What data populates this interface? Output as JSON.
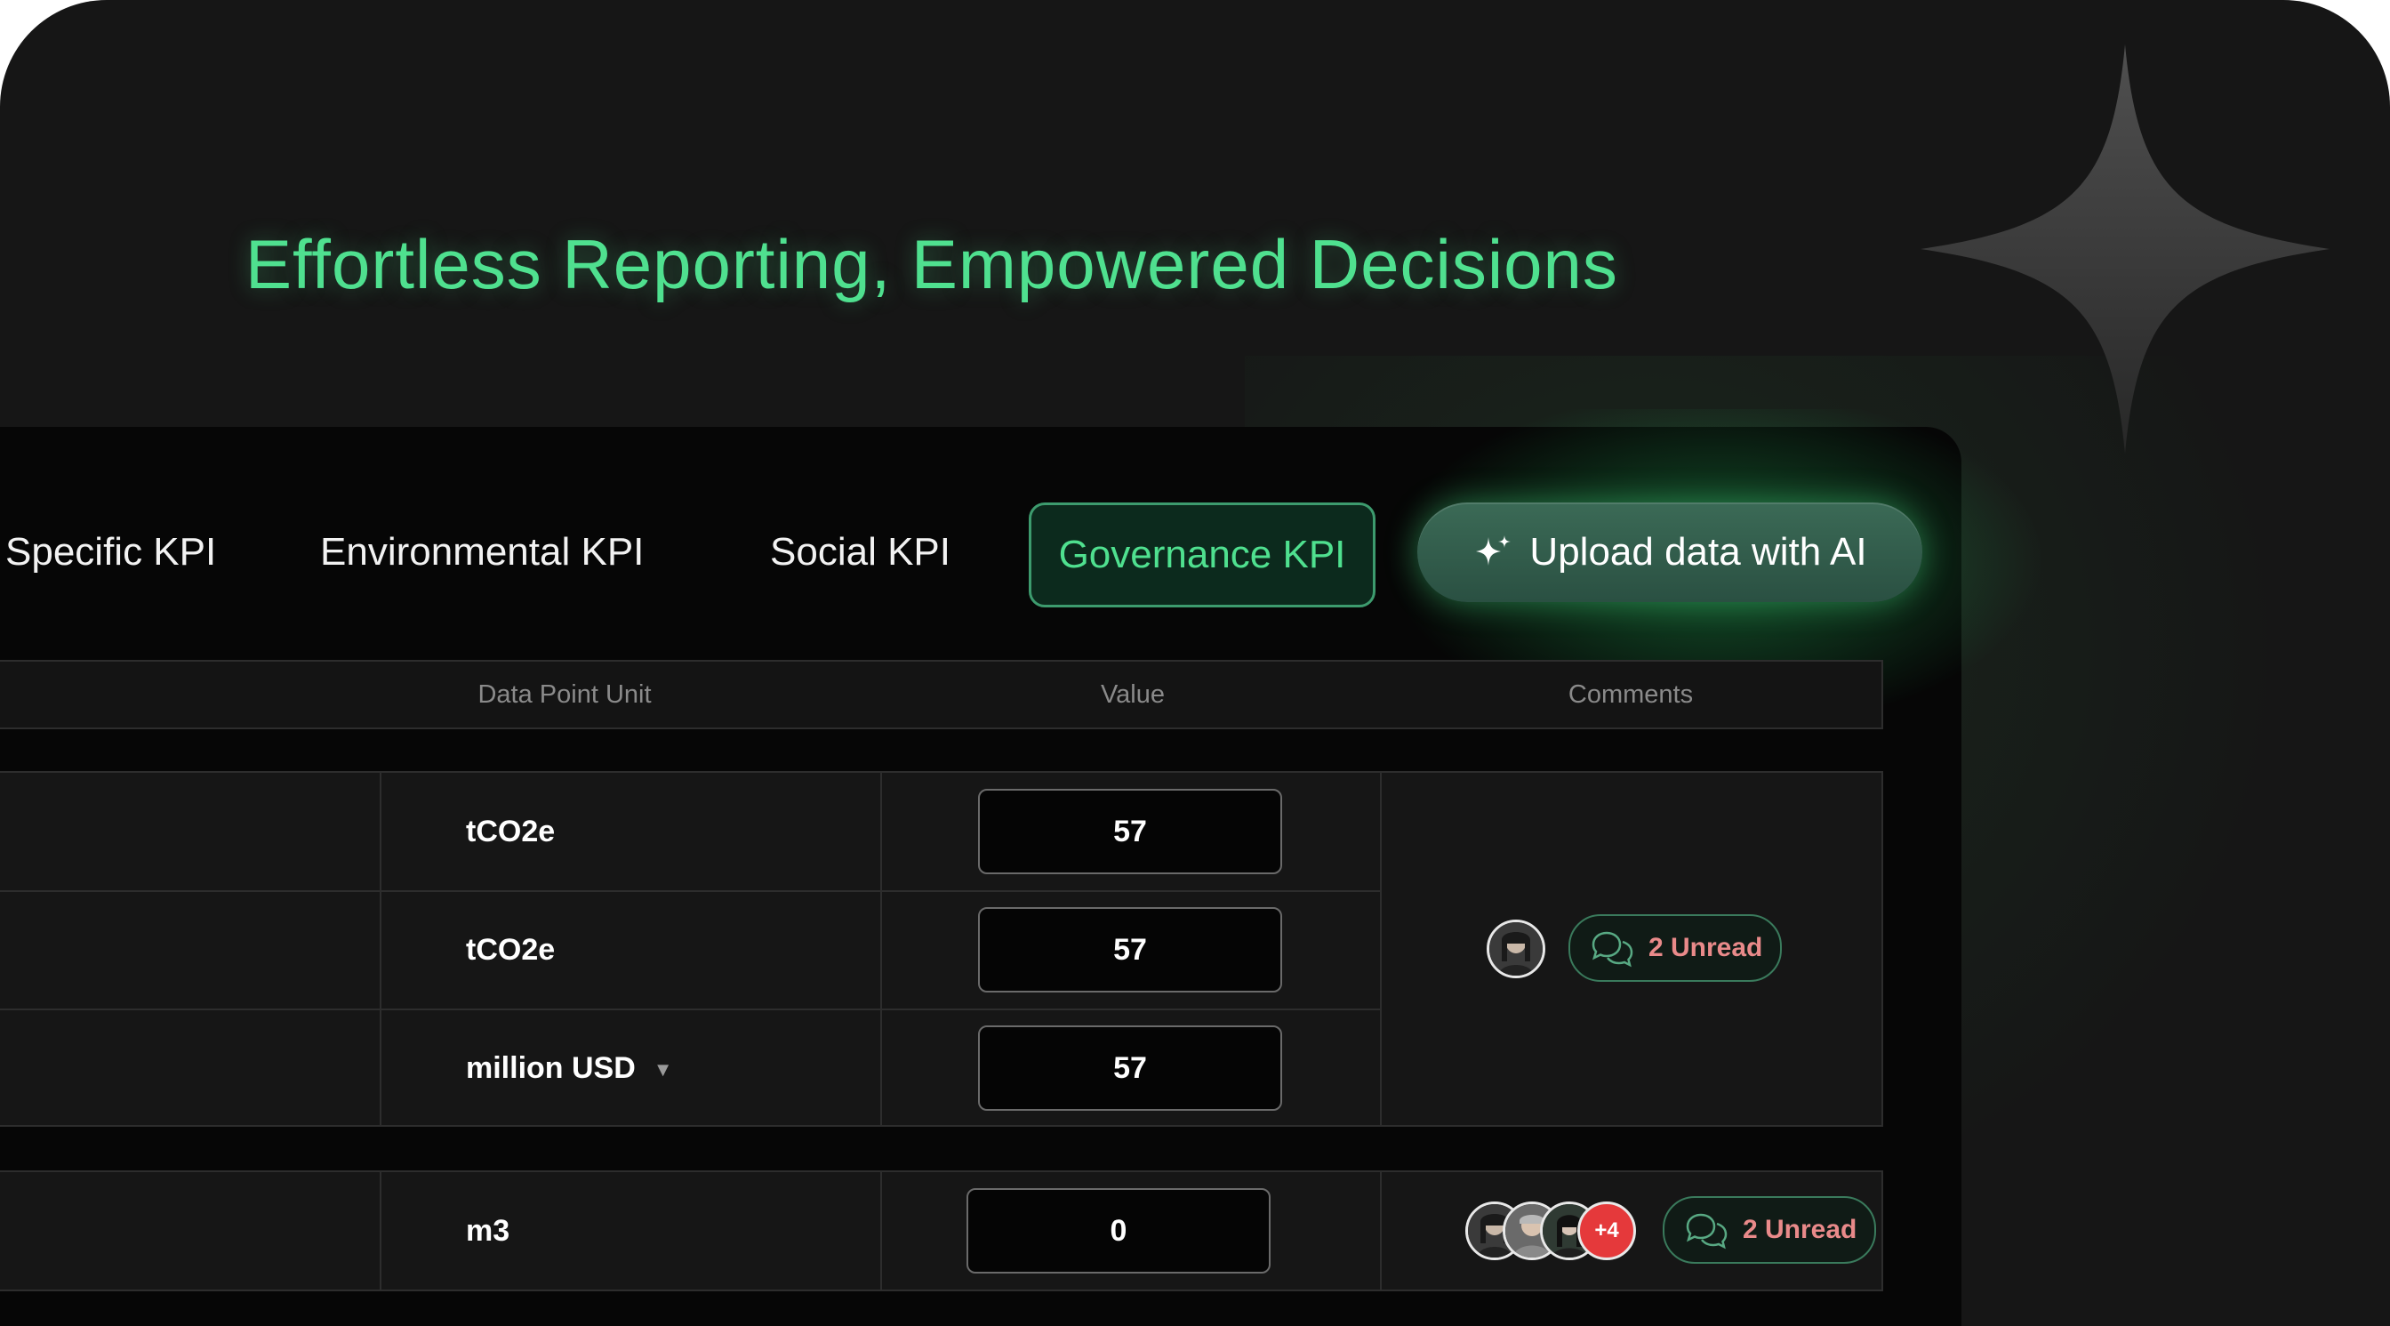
{
  "hero": {
    "title": "Effortless Reporting, Empowered Decisions"
  },
  "tabs": [
    {
      "label": "Specific KPI",
      "active": false
    },
    {
      "label": "Environmental KPI",
      "active": false
    },
    {
      "label": "Social KPI",
      "active": false
    },
    {
      "label": "Governance KPI",
      "active": true
    }
  ],
  "ai_button": {
    "label": "Upload data with AI",
    "icon": "sparkle-icon"
  },
  "table": {
    "columns": [
      "Data Point Unit",
      "Value",
      "Comments"
    ],
    "groups": [
      {
        "rows": [
          {
            "unit": "tCO2e",
            "value": "57",
            "has_dropdown": false
          },
          {
            "unit": "tCO2e",
            "value": "57",
            "has_dropdown": false
          },
          {
            "unit": "million USD",
            "value": "57",
            "has_dropdown": true
          }
        ],
        "comments": {
          "unread": "2 Unread",
          "extra_avatars": ""
        }
      },
      {
        "rows": [
          {
            "unit": "m3",
            "value": "0",
            "has_dropdown": false
          }
        ],
        "comments": {
          "unread": "2 Unread",
          "extra_avatars": "+4"
        }
      }
    ]
  },
  "colors": {
    "accent_green": "#4fe08f",
    "unread_text": "#e98a8a",
    "badge_red": "#e5393b",
    "background": "#161616"
  }
}
